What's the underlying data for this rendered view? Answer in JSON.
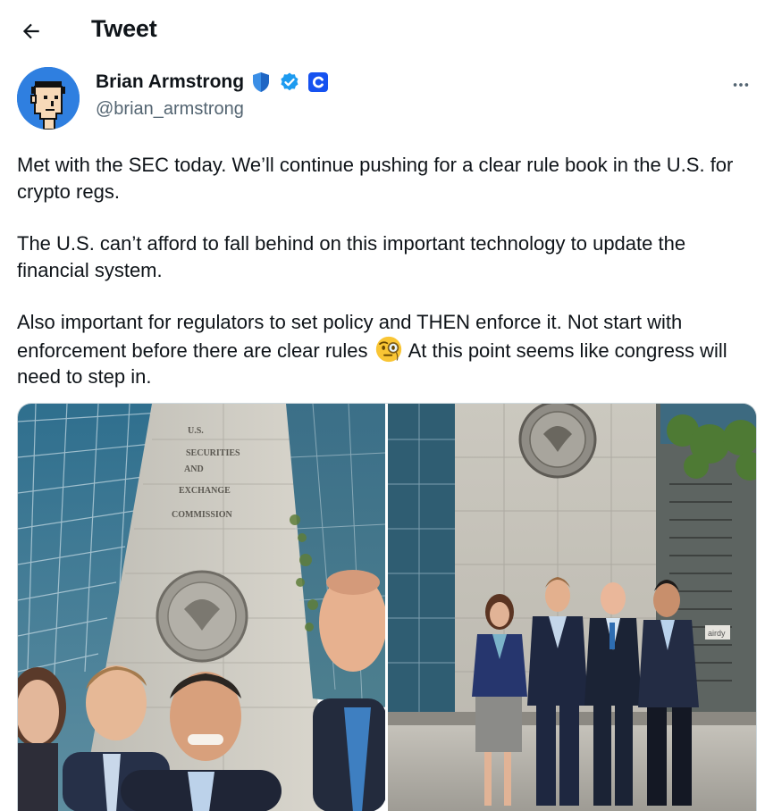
{
  "header": {
    "title": "Tweet",
    "back_icon": "arrow-left-icon"
  },
  "author": {
    "name": "Brian Armstrong",
    "handle": "@brian_armstrong",
    "badges": [
      "shield-icon",
      "verified-check-icon",
      "coinbase-logo-icon"
    ],
    "colors": {
      "verified": "#1d9bf0",
      "coinbase": "#1652f0",
      "shield": "#3a8ee6"
    }
  },
  "tweet": {
    "paragraphs": [
      "Met with the SEC today. We’ll continue pushing for a clear rule book in the U.S. for crypto regs.",
      "The U.S. can’t afford to fall behind on this important technology to update the financial system."
    ],
    "p3_before_emoji": "Also important for regulators to set policy and THEN enforce it. Not start with enforcement before there are clear rules",
    "p3_emoji": "face-with-monocle-emoji",
    "p3_after_emoji": "At this point seems like congress will need to step in."
  },
  "media": {
    "photo1": {
      "building_lettering": [
        "U.S.",
        "SECURITIES",
        "AND",
        "EXCHANGE",
        "COMMISSION"
      ]
    },
    "photo2": {
      "sign_text": "airdy"
    }
  },
  "more_icon": "more-horizontal-icon"
}
